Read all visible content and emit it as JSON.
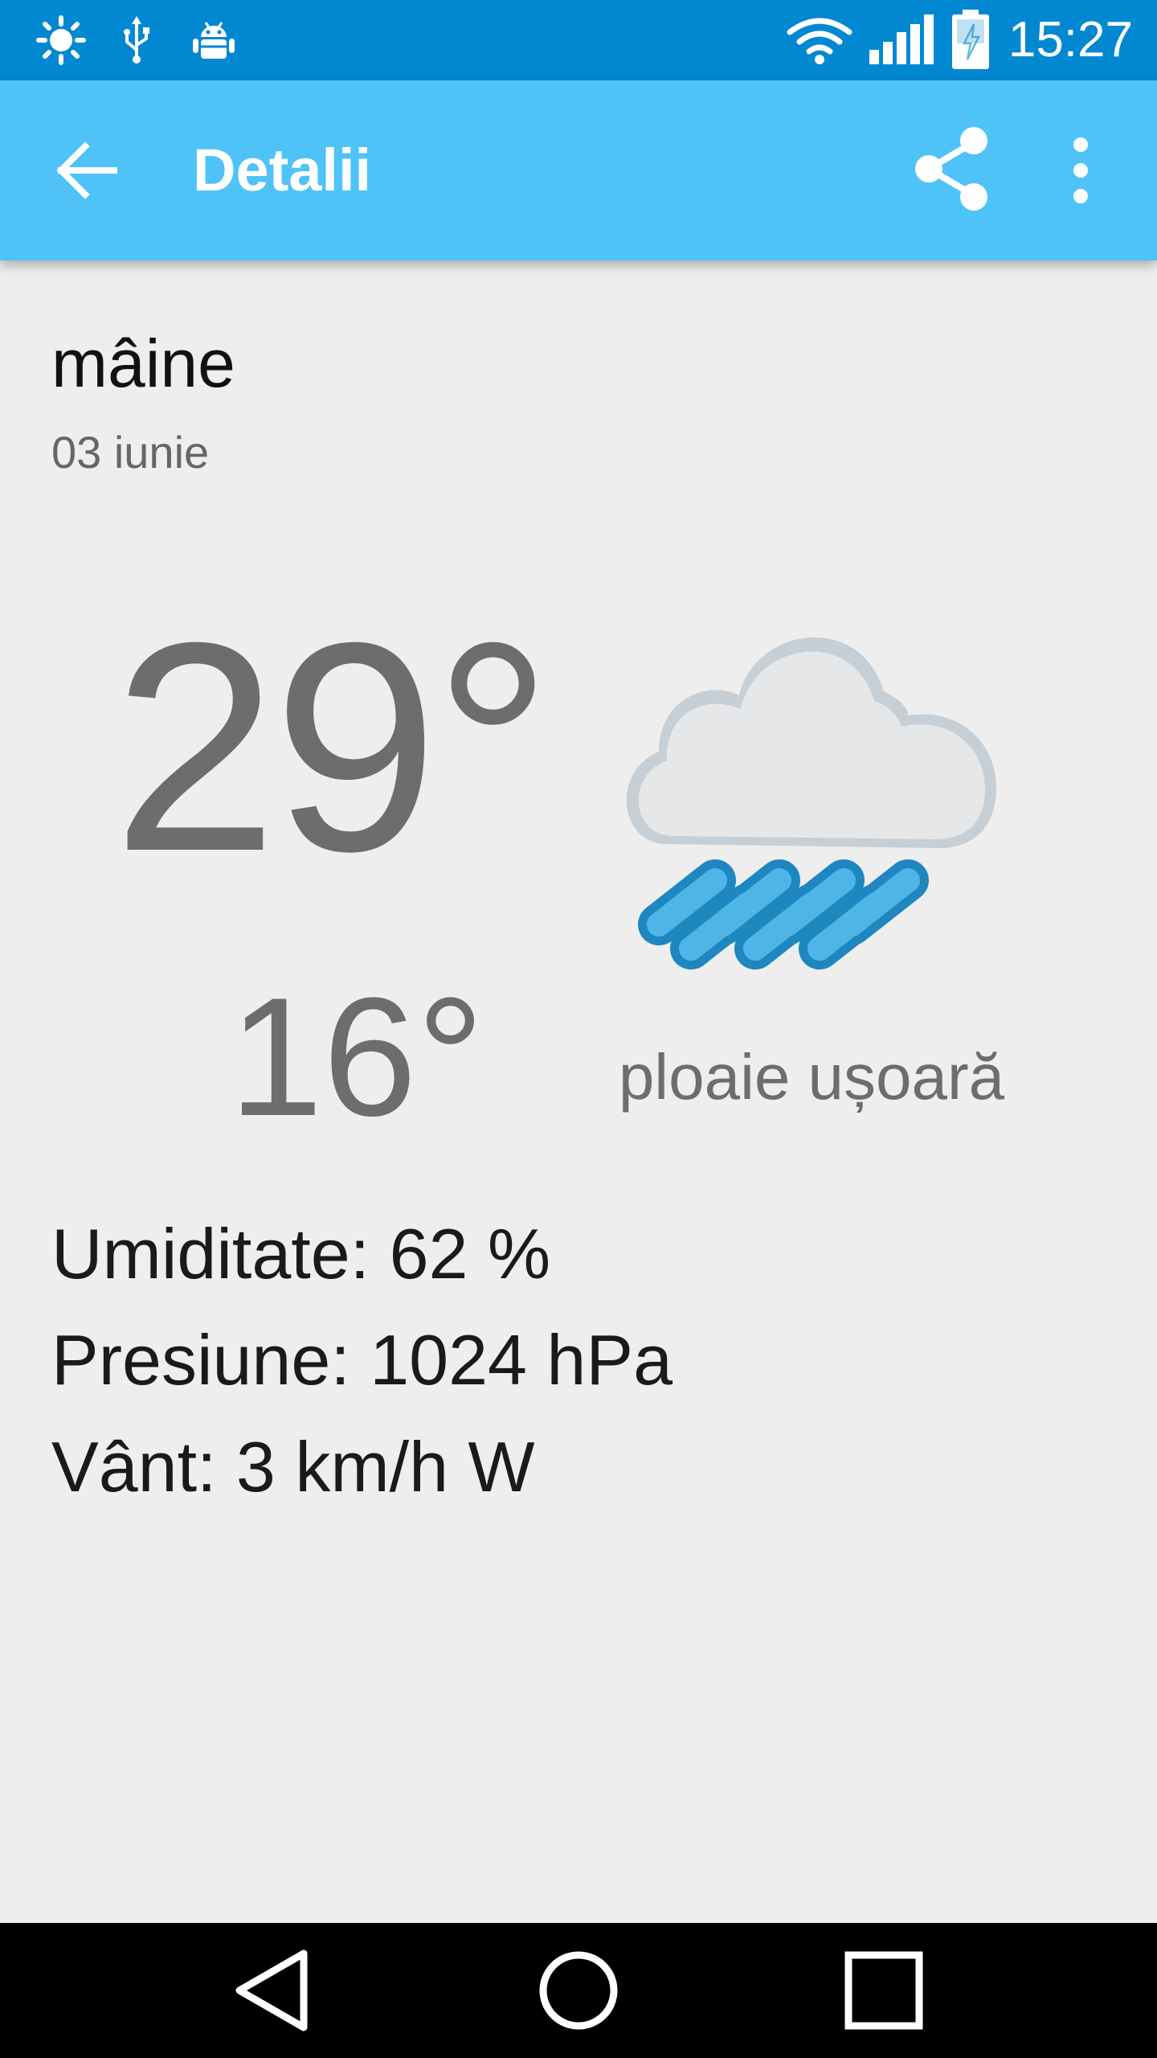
{
  "status_bar": {
    "time": "15:27",
    "icons": [
      "brightness-icon",
      "usb-icon",
      "android-debug-icon",
      "wifi-icon",
      "signal-icon",
      "battery-charging-icon"
    ]
  },
  "app_bar": {
    "title": "Detalii",
    "back_icon": "arrow-back-icon",
    "share_icon": "share-icon",
    "menu_icon": "more-vert-icon"
  },
  "forecast": {
    "day": "mâine",
    "date": "03 iunie",
    "temp_high": "29°",
    "temp_low": "16°",
    "condition": "ploaie ușoară",
    "condition_icon": "light-rain-icon"
  },
  "details": {
    "humidity": "Umiditate: 62 %",
    "pressure": "Presiune: 1024 hPa",
    "wind": "Vânt: 3 km/h W"
  },
  "nav_bar": {
    "icons": [
      "nav-back-icon",
      "nav-home-icon",
      "nav-recents-icon"
    ]
  },
  "colors": {
    "status_bar": "#0288d1",
    "app_bar": "#4fc3f7",
    "background": "#eeeeee",
    "rain": "#4db6e6",
    "rain_dark": "#1f87c0"
  }
}
